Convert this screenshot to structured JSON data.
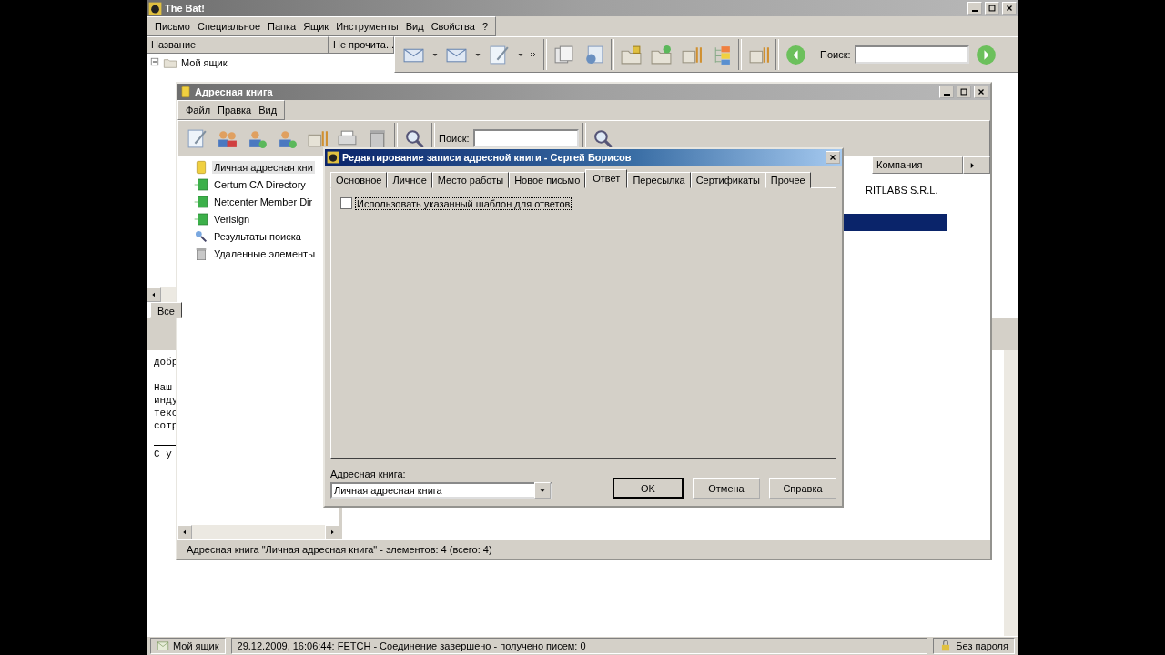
{
  "main_window": {
    "title": "The Bat!",
    "menu": [
      "Письмо",
      "Специальное",
      "Папка",
      "Ящик",
      "Инструменты",
      "Вид",
      "Свойства",
      "?"
    ],
    "folder_pane": {
      "columns": [
        "Название",
        "Не прочита..."
      ],
      "tree": [
        {
          "label": "Мой ящик",
          "expanded": true
        }
      ],
      "tab": "Все"
    },
    "search": {
      "label": "Поиск:"
    },
    "preview": {
      "paragraphs": [
        [
          "добр"
        ],
        [
          "Наш",
          "инду",
          "текс",
          "сотр"
        ]
      ],
      "signature": [
        "С у"
      ]
    },
    "status_bar": {
      "account": "Мой ящик",
      "log": "29.12.2009, 16:06:44: FETCH - Соединение завершено - получено писем: 0",
      "security": "Без пароля"
    }
  },
  "address_book": {
    "title": "Адресная книга",
    "menu": [
      "Файл",
      "Правка",
      "Вид"
    ],
    "search": {
      "label": "Поиск:"
    },
    "tree": [
      {
        "label": "Личная адресная кни",
        "kind": "book",
        "selected": true
      },
      {
        "label": "Certum CA Directory",
        "kind": "directory",
        "selected": false
      },
      {
        "label": "Netcenter Member Dir",
        "kind": "directory",
        "selected": false
      },
      {
        "label": "Verisign",
        "kind": "directory",
        "selected": false
      },
      {
        "label": "Результаты поиска",
        "kind": "search",
        "selected": false
      },
      {
        "label": "Удаленные элементы",
        "kind": "trash",
        "selected": false
      }
    ],
    "columns": [
      "Компания"
    ],
    "rows": [
      {
        "company": "RITLABS S.R.L.",
        "selected": false
      },
      {
        "selected": true
      }
    ],
    "status_bar": "Адресная книга \"Личная адресная книга\" - элементов: 4 (всего: 4)"
  },
  "dialog": {
    "title": "Редактирование записи адресной книги - Сергей Борисов",
    "tabs": [
      {
        "label": "Основное",
        "selected": false
      },
      {
        "label": "Личное",
        "selected": false
      },
      {
        "label": "Место работы",
        "selected": false
      },
      {
        "label": "Новое письмо",
        "selected": false
      },
      {
        "label": "Ответ",
        "selected": true
      },
      {
        "label": "Пересылка",
        "selected": false
      },
      {
        "label": "Сертификаты",
        "selected": false
      },
      {
        "label": "Прочее",
        "selected": false
      }
    ],
    "option": {
      "label": "Использовать указанный шаблон для ответов",
      "checked": false
    },
    "book_label": "Адресная книга:",
    "book_value": "Личная адресная книга",
    "buttons": [
      "OK",
      "Отмена",
      "Справка"
    ]
  }
}
